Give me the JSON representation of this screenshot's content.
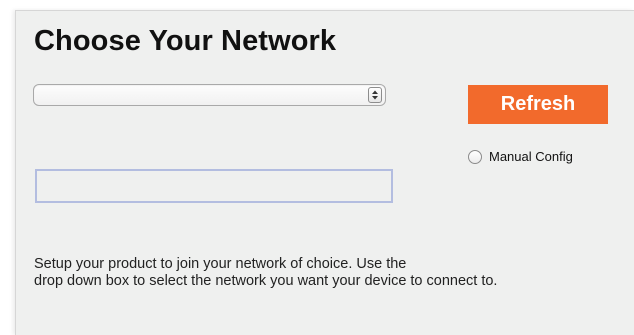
{
  "page": {
    "title": "Choose Your Network"
  },
  "network_select": {
    "selected_value": ""
  },
  "refresh_button": {
    "label": "Refresh",
    "color": "#f26a2c"
  },
  "manual_config": {
    "label": "Manual Config",
    "checked": false
  },
  "network_input": {
    "value": "",
    "border_color": "#b3bde0"
  },
  "description": {
    "line1": "Setup your product to join your network of choice. Use the",
    "line2": "drop down box to select the network you want your device to connect to."
  },
  "icons": {
    "select_arrows": "up-down-arrows-icon",
    "radio": "radio-button-icon"
  }
}
